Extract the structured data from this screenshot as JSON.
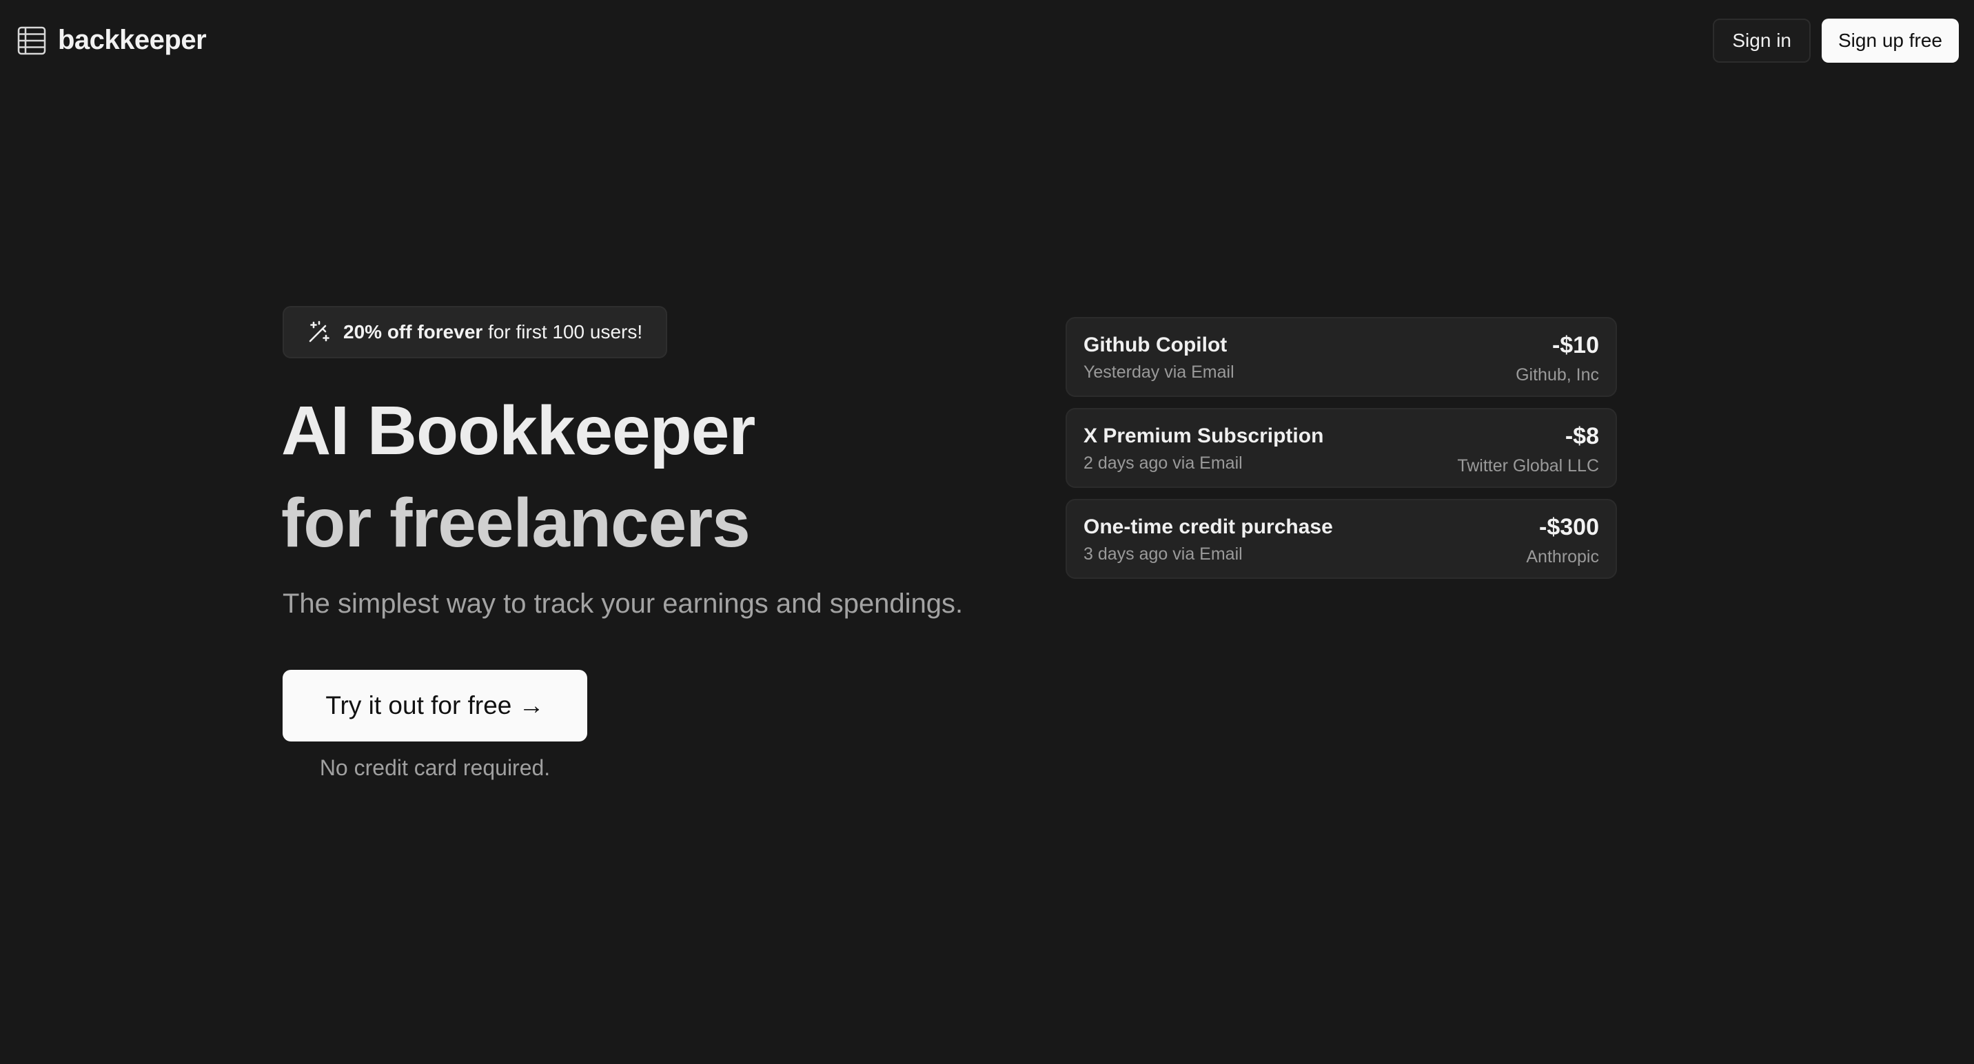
{
  "header": {
    "brand": "backkeeper",
    "logo_icon": "table-icon",
    "sign_in_label": "Sign in",
    "sign_up_label": "Sign up free"
  },
  "hero": {
    "promo": {
      "icon": "magic-wand-icon",
      "strong": "20% off forever",
      "rest": " for first 100 users!"
    },
    "title_line1": "AI Bookkeeper",
    "title_line2": "for freelancers",
    "subtitle": "The simplest way to track your earnings and spendings.",
    "cta_label": "Try it out for free →",
    "cta_note": "No credit card required."
  },
  "transactions": [
    {
      "name": "Github Copilot",
      "meta": "Yesterday via Email",
      "amount": "-$10",
      "vendor": "Github, Inc"
    },
    {
      "name": "X Premium Subscription",
      "meta": "2 days ago via Email",
      "amount": "-$8",
      "vendor": "Twitter Global LLC"
    },
    {
      "name": "One-time credit purchase",
      "meta": "3 days ago via Email",
      "amount": "-$300",
      "vendor": "Anthropic"
    }
  ],
  "colors": {
    "background": "#181818",
    "card": "#232323",
    "button_light": "#fafafa"
  }
}
